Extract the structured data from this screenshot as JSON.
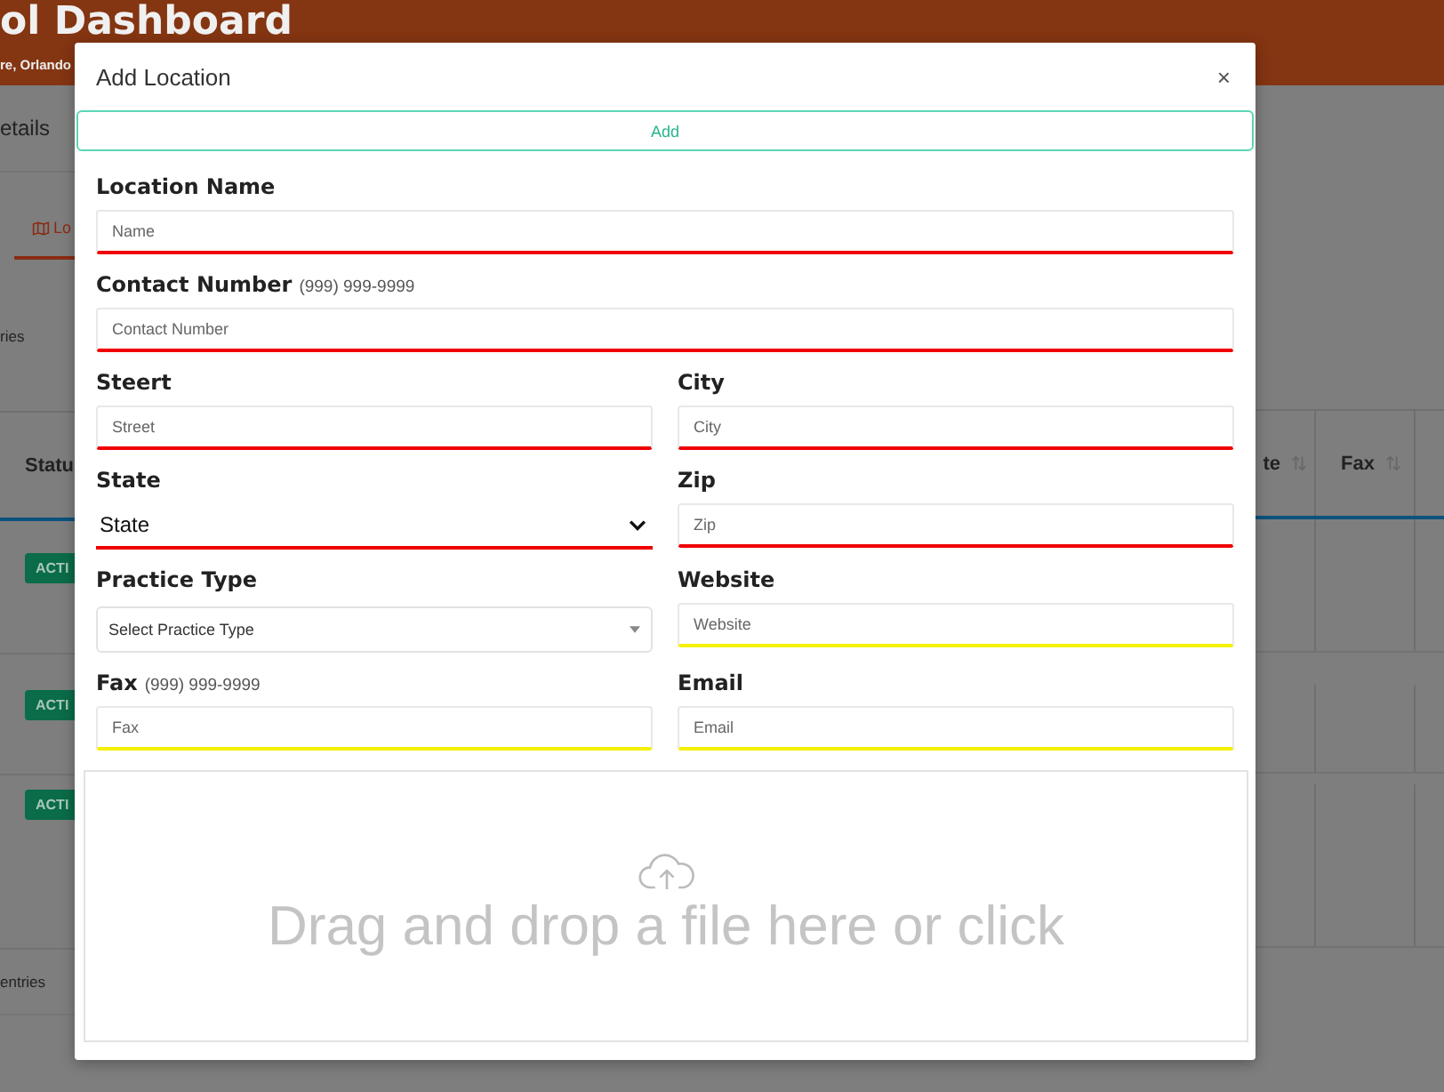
{
  "background": {
    "header_title": "ol Dashboard",
    "header_subtitle": "re, Orlando",
    "tab_label": "etails",
    "location_tab": "Lo",
    "entries_top": "ries",
    "status_column": "Statu",
    "right_columns": [
      "te",
      "Fax"
    ],
    "badges": [
      "ACTI",
      "ACTI",
      "ACTI"
    ],
    "entries_bottom": "entries"
  },
  "dialog": {
    "title": "Add Location",
    "close": "×",
    "add_button": "Add",
    "fields": [
      {
        "label": "Location Name",
        "placeholder": "Name",
        "kind": "text",
        "wide": true,
        "required": true
      },
      {
        "label": "Contact Number",
        "hint": "(999) 999-9999",
        "placeholder": "Contact Number",
        "kind": "text",
        "wide": true,
        "required": true
      },
      {
        "label": "Steert",
        "placeholder": "Street",
        "kind": "text",
        "wide": false,
        "required": true
      },
      {
        "label": "City",
        "placeholder": "City",
        "kind": "text",
        "wide": false,
        "required": true
      },
      {
        "label": "State",
        "value": "State",
        "kind": "select",
        "wide": false,
        "required": true
      },
      {
        "label": "Zip",
        "placeholder": "Zip",
        "kind": "text",
        "wide": false,
        "required": true
      },
      {
        "label": "Practice Type",
        "value": "Select Practice Type",
        "kind": "dropdown",
        "wide": false
      },
      {
        "label": "Website",
        "placeholder": "Website",
        "kind": "text",
        "wide": false,
        "required": false
      },
      {
        "label": "Fax",
        "hint": "(999) 999-9999",
        "placeholder": "Fax",
        "kind": "text",
        "wide": false,
        "required": false
      },
      {
        "label": "Email",
        "placeholder": "Email",
        "kind": "text",
        "wide": false,
        "required": false
      }
    ],
    "dropzone": {
      "text": "Drag and drop a file here or click"
    }
  }
}
